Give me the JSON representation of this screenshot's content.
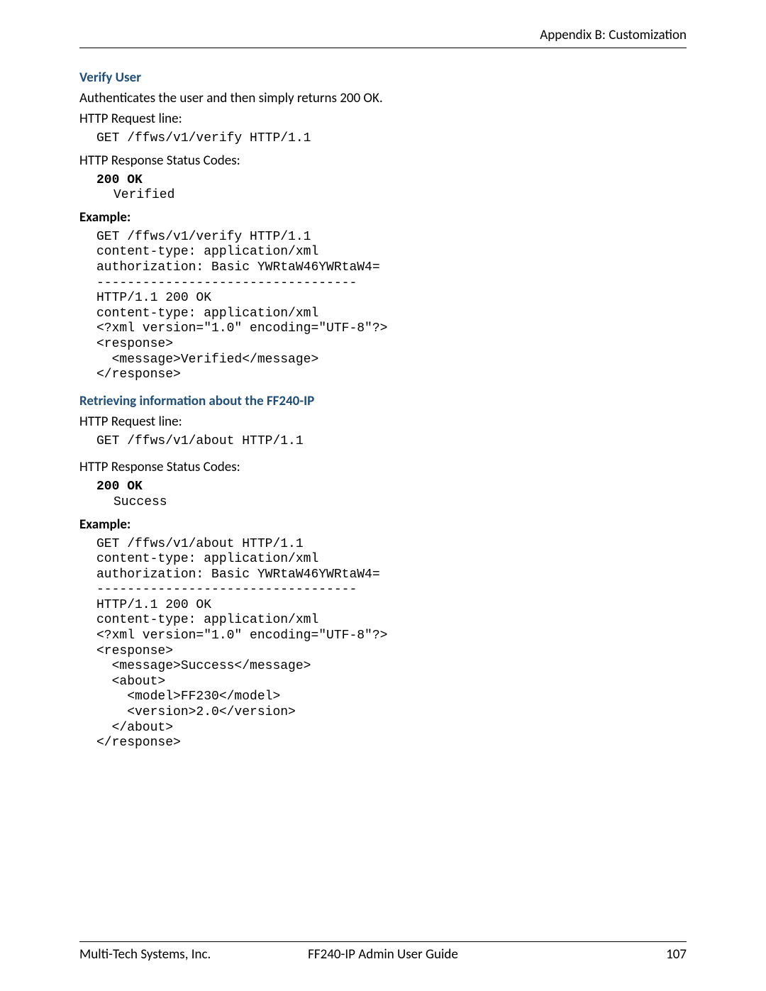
{
  "header": {
    "title": "Appendix B: Customization"
  },
  "section1": {
    "heading": "Verify User",
    "desc": "Authenticates the user and then simply returns 200 OK.",
    "req_label": "HTTP Request line:",
    "req_line": "GET /ffws/v1/verify HTTP/1.1",
    "resp_label": "HTTP Response Status Codes:",
    "resp_code": "200 OK",
    "resp_msg": "Verified",
    "example_label": "Example:",
    "example": "GET /ffws/v1/verify HTTP/1.1\ncontent-type: application/xml\nauthorization: Basic YWRtaW46YWRtaW4=\n----------------------------------\nHTTP/1.1 200 OK\ncontent-type: application/xml\n<?xml version=\"1.0\" encoding=\"UTF-8\"?>\n<response>\n  <message>Verified</message>\n</response>"
  },
  "section2": {
    "heading": "Retrieving information about the FF240-IP",
    "req_label": "HTTP Request line:",
    "req_line": "GET /ffws/v1/about HTTP/1.1",
    "resp_label": "HTTP Response Status Codes:",
    "resp_code": "200 OK",
    "resp_msg": "Success",
    "example_label": "Example:",
    "example": "GET /ffws/v1/about HTTP/1.1\ncontent-type: application/xml\nauthorization: Basic YWRtaW46YWRtaW4=\n----------------------------------\nHTTP/1.1 200 OK\ncontent-type: application/xml\n<?xml version=\"1.0\" encoding=\"UTF-8\"?>\n<response>\n  <message>Success</message>\n  <about>\n    <model>FF230</model>\n    <version>2.0</version>\n  </about>\n</response>"
  },
  "footer": {
    "left": "Multi-Tech Systems, Inc.",
    "center": "FF240-IP Admin User Guide",
    "right": "107"
  }
}
